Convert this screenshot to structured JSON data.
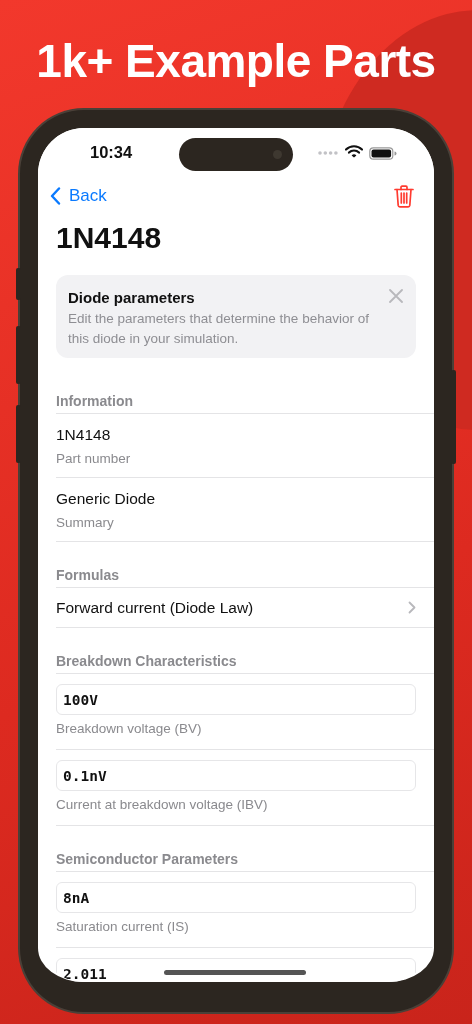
{
  "headline": "1k+ Example Parts",
  "status_bar": {
    "time": "10:34"
  },
  "nav": {
    "back": "Back"
  },
  "title": "1N4148",
  "tip": {
    "title": "Diode parameters",
    "text": "Edit the parameters that determine the behavior of this diode in your simulation."
  },
  "sections": [
    {
      "header": "Information",
      "rows": [
        {
          "kind": "text",
          "value": "1N4148",
          "caption": "Part number"
        },
        {
          "kind": "text",
          "value": "Generic Diode",
          "caption": "Summary"
        }
      ]
    },
    {
      "header": "Formulas",
      "rows": [
        {
          "kind": "link",
          "label": "Forward current (Diode Law)"
        }
      ]
    },
    {
      "header": "Breakdown Characteristics",
      "rows": [
        {
          "kind": "field",
          "value": "100V",
          "caption": "Breakdown voltage (BV)"
        },
        {
          "kind": "field",
          "value": "0.1nV",
          "caption": "Current at breakdown voltage (IBV)"
        }
      ]
    },
    {
      "header": "Semiconductor Parameters",
      "rows": [
        {
          "kind": "field",
          "value": "8nA",
          "caption": "Saturation current (IS)"
        },
        {
          "kind": "field",
          "value": "2.011"
        }
      ]
    }
  ]
}
